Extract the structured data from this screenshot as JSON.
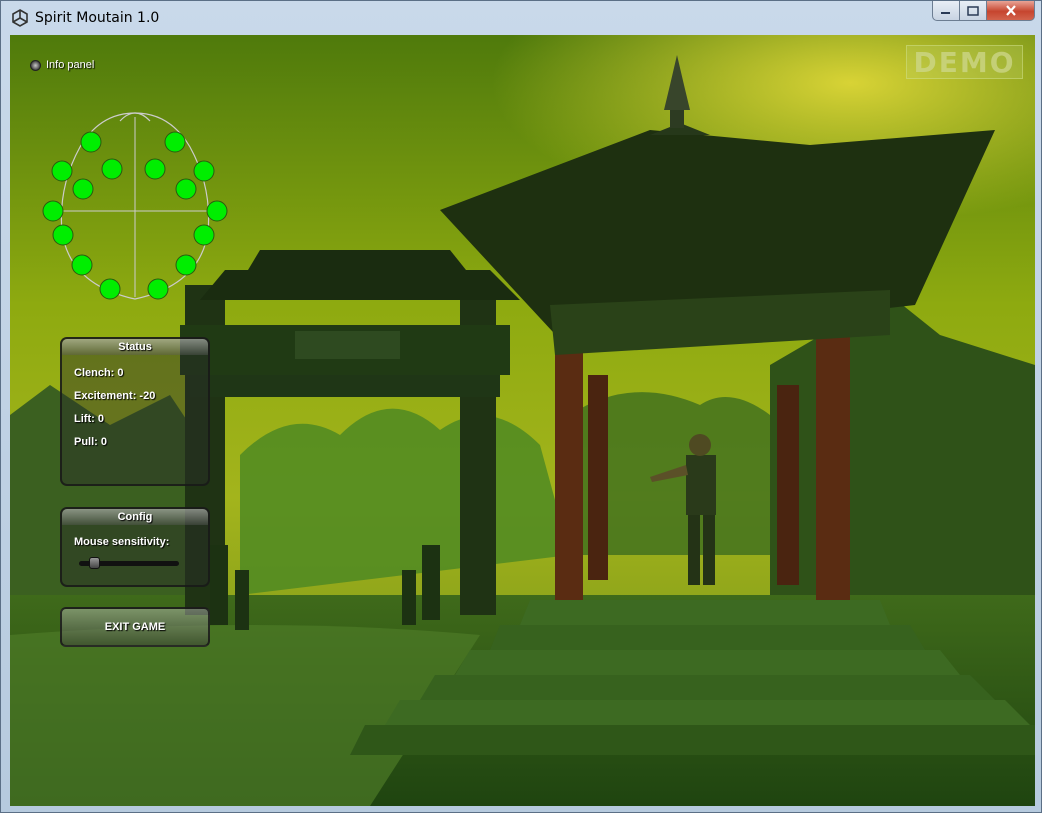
{
  "window": {
    "title": "Spirit Moutain 1.0"
  },
  "hud": {
    "info_panel_label": "Info panel",
    "demo_watermark": "DEMO"
  },
  "status": {
    "title": "Status",
    "clench": "Clench: 0",
    "excitement": "Excitement: -20",
    "lift": "Lift: 0",
    "pull": "Pull: 0"
  },
  "config": {
    "title": "Config",
    "mouse_sensitivity_label": "Mouse sensitivity:",
    "mouse_sensitivity_value": 0.15
  },
  "exit_button": "EXIT GAME",
  "sensor_map": {
    "sensor_count": 16,
    "contact_color": "#00ee00"
  },
  "colors": {
    "sky": "#8faa10",
    "contact_good": "#00ee00",
    "close_button": "#c6452f"
  }
}
